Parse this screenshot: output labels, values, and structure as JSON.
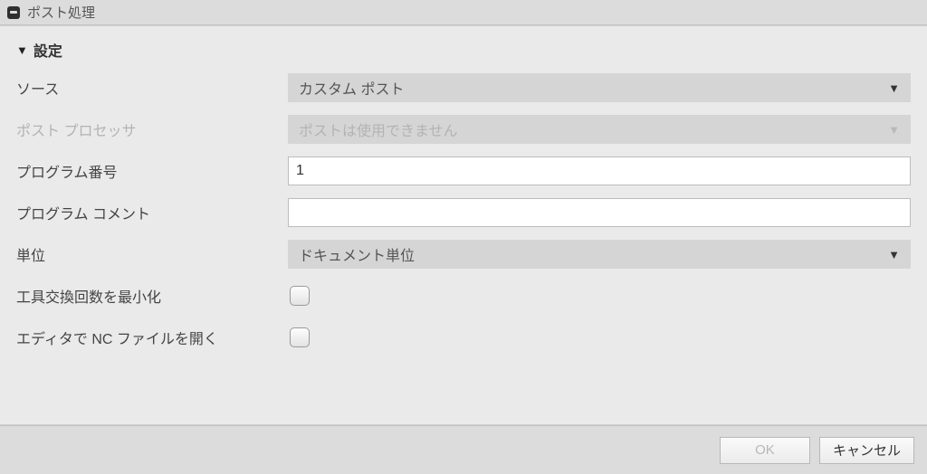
{
  "window": {
    "title": "ポスト処理"
  },
  "section": {
    "title": "設定"
  },
  "rows": {
    "source": {
      "label": "ソース",
      "value": "カスタム ポスト"
    },
    "postproc": {
      "label": "ポスト プロセッサ",
      "value": "ポストは使用できません"
    },
    "prognum": {
      "label": "プログラム番号",
      "value": "1"
    },
    "progcmt": {
      "label": "プログラム コメント",
      "value": ""
    },
    "units": {
      "label": "単位",
      "value": "ドキュメント単位"
    },
    "mintool": {
      "label": "工具交換回数を最小化"
    },
    "opennc": {
      "label": "エディタで NC ファイルを開く"
    }
  },
  "buttons": {
    "ok": "OK",
    "cancel": "キャンセル"
  }
}
